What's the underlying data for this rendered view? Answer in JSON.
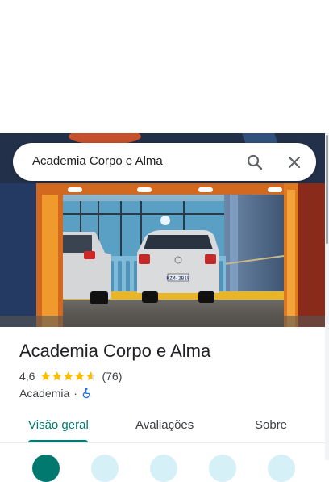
{
  "search": {
    "query": "Academia Corpo e Alma",
    "search_icon": "search-icon",
    "close_icon": "close-icon"
  },
  "place": {
    "name": "Academia Corpo e Alma",
    "rating": "4,6",
    "stars": 4.6,
    "review_count": "(76)",
    "category": "Academia",
    "separator": "·",
    "accessibility_icon": "wheelchair-icon"
  },
  "photo": {
    "license_plate": "KZM-2B18"
  },
  "tabs": [
    {
      "label": "Visão geral",
      "active": true
    },
    {
      "label": "Avaliações",
      "active": false
    },
    {
      "label": "Sobre",
      "active": false
    }
  ],
  "colors": {
    "accent": "#01796f",
    "star": "#fbbc04",
    "star_empty": "#dadce0",
    "text_primary": "#202124",
    "text_secondary": "#3c4043",
    "icon_blue": "#1a73e8",
    "action_light": "#d6f0f7"
  }
}
